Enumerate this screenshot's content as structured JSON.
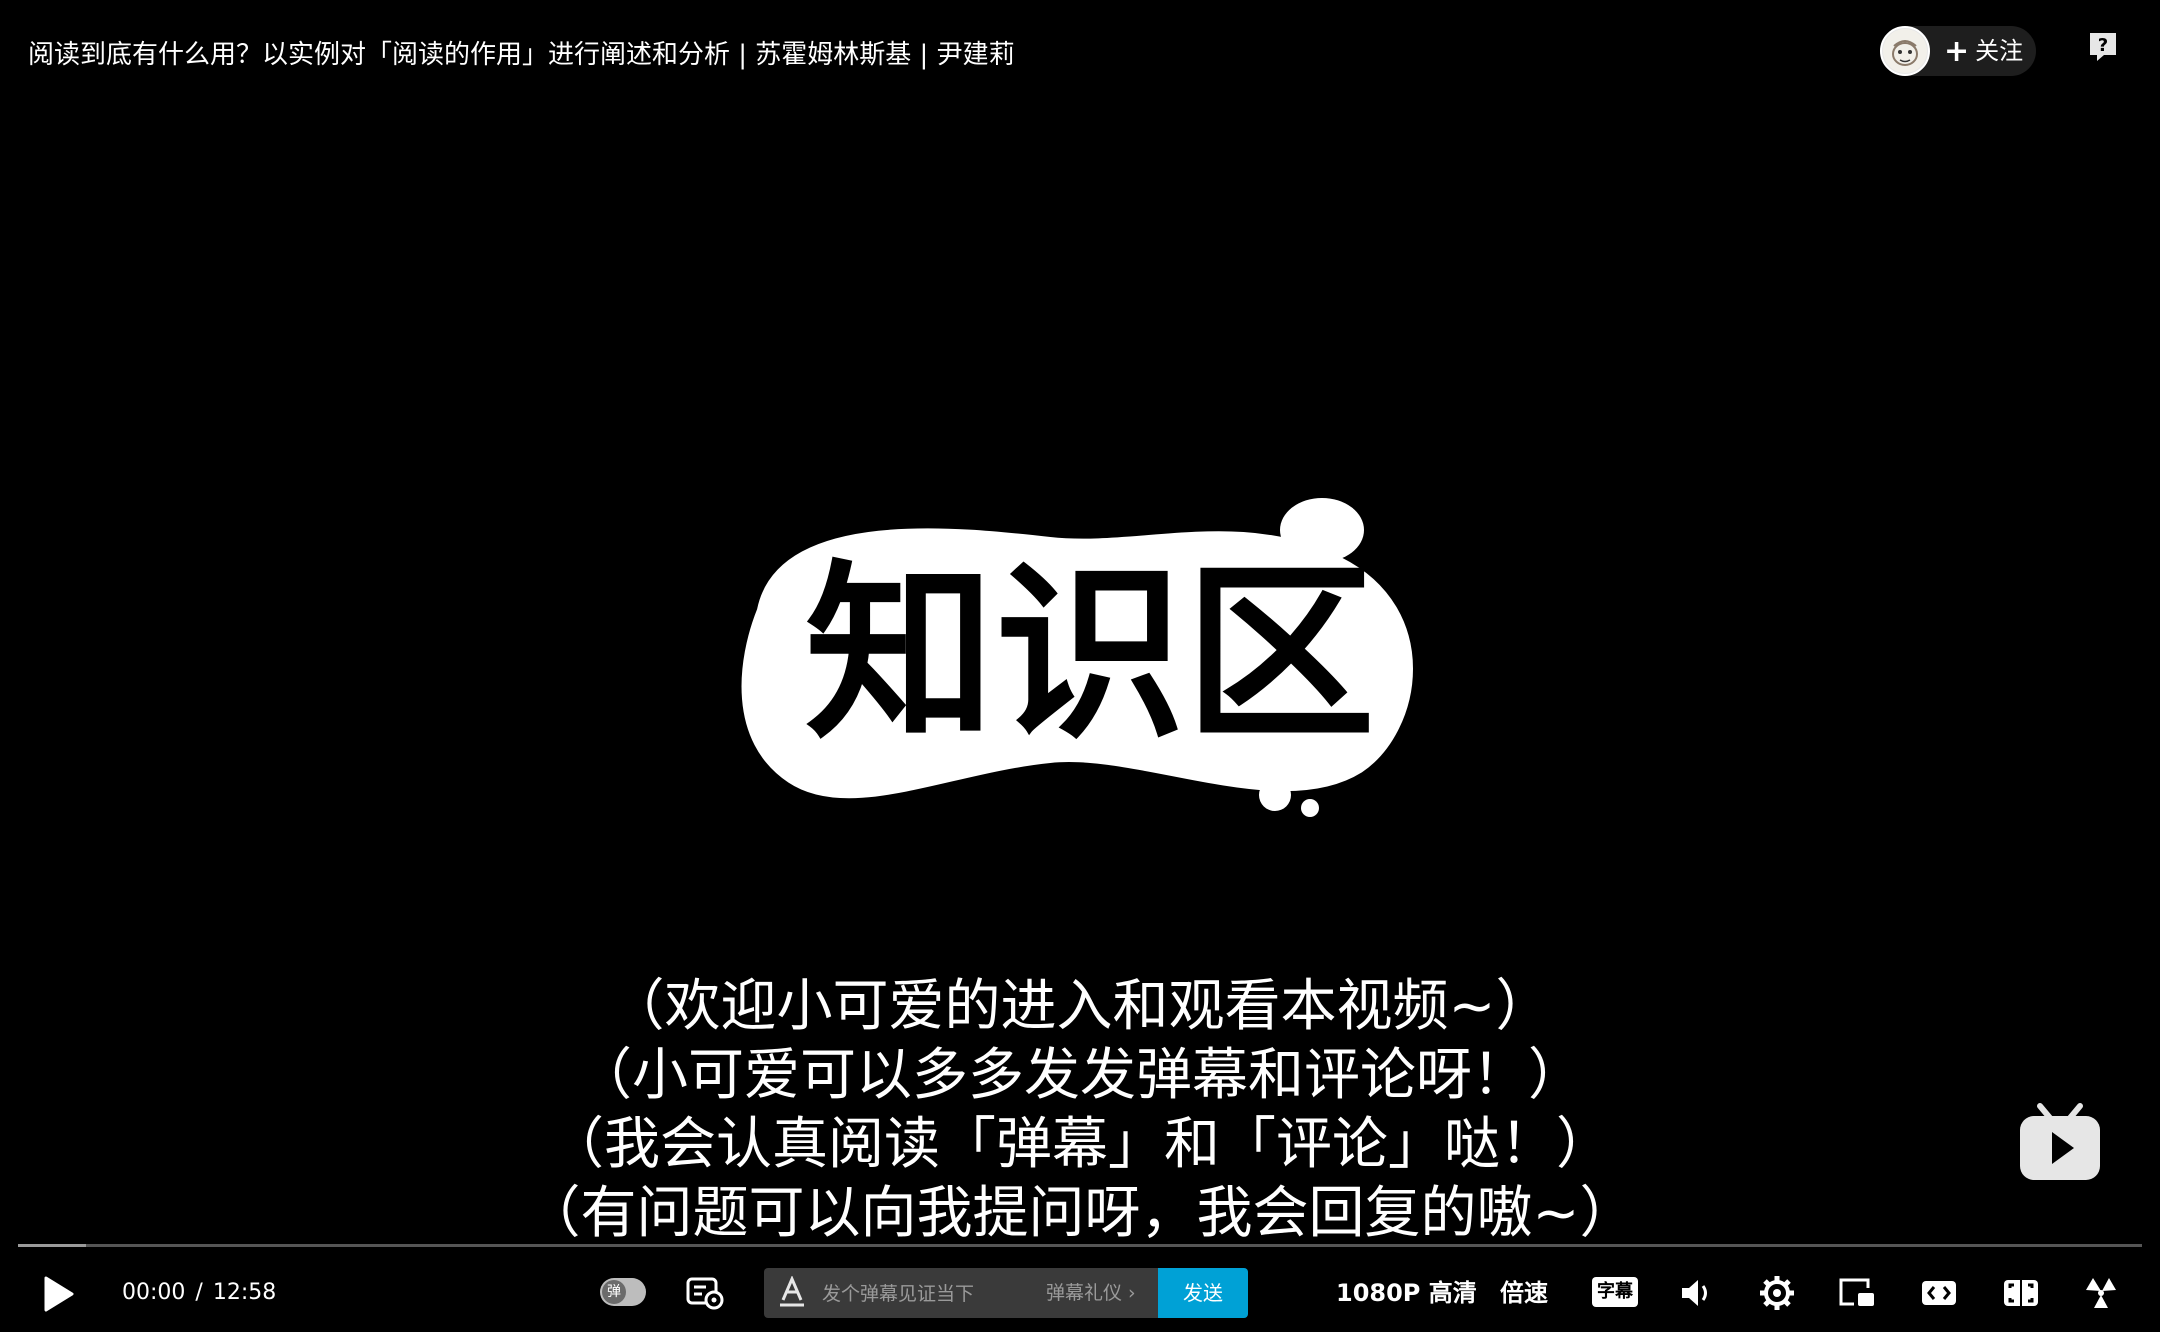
{
  "header": {
    "title": "阅读到底有什么用？以实例对「阅读的作用」进行阐述和分析 | 苏霍姆林斯基 | 尹建莉",
    "follow_label": "关注",
    "follow_plus": "+"
  },
  "video": {
    "logo_text": "知识区",
    "subtitles": [
      "（欢迎小可爱的进入和观看本视频~）",
      "（小可爱可以多多发发弹幕和评论呀！）",
      "（我会认真阅读「弹幕」和「评论」哒！）",
      "（有问题可以向我提问呀，我会回复的嗷~）"
    ]
  },
  "controls": {
    "current_time": "00:00",
    "time_separator": "/",
    "duration": "12:58",
    "danmaku_toggle_label": "弹",
    "danmaku_placeholder": "发个弹幕见证当下",
    "danmaku_etiquette": "弹幕礼仪 ›",
    "send_label": "发送",
    "quality_label": "1080P 高清",
    "speed_label": "倍速",
    "subtitle_label": "字幕"
  },
  "progress": {
    "played_fraction": 0.0
  },
  "icons": {
    "play": "play-icon",
    "danmaku_settings": "danmaku-settings-icon",
    "font": "font-style-icon",
    "volume": "volume-icon",
    "settings": "gear-icon",
    "pip": "picture-in-picture-icon",
    "widescreen": "widescreen-icon",
    "web_fullscreen": "web-fullscreen-icon",
    "fullscreen": "fullscreen-icon",
    "help": "help-icon",
    "tv": "bilibili-tv-icon"
  },
  "colors": {
    "background": "#000000",
    "send_button": "#00a1d6",
    "input_background": "#3a3a3a"
  }
}
